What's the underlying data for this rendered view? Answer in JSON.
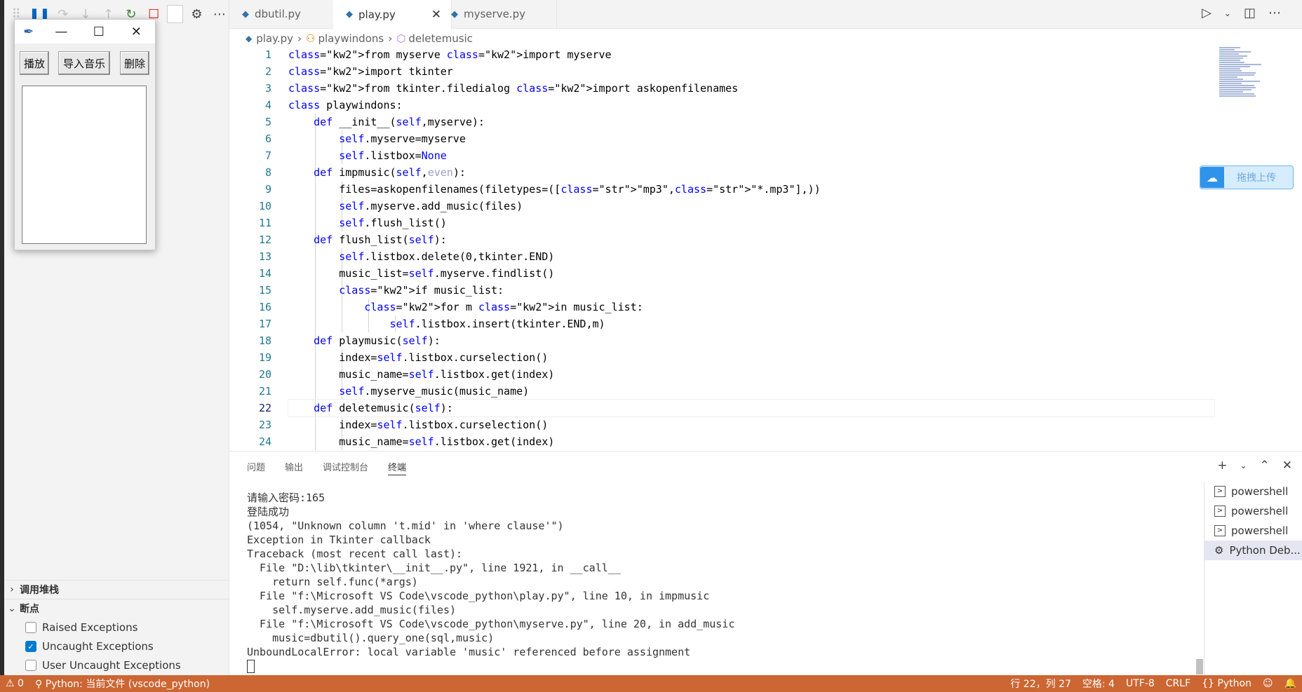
{
  "debug_toolbar": {
    "icons": [
      "gripper-icon",
      "pause-icon",
      "step-over-icon",
      "step-into-icon",
      "step-out-icon",
      "restart-icon",
      "stop-icon"
    ]
  },
  "sidebar": {
    "call_stack_label": "调用堆栈",
    "breakpoints_label": "断点",
    "breakpoints": [
      {
        "label": "Raised Exceptions",
        "checked": false
      },
      {
        "label": "Uncaught Exceptions",
        "checked": true
      },
      {
        "label": "User Uncaught Exceptions",
        "checked": false
      }
    ]
  },
  "tk_window": {
    "buttons": {
      "play": "播放",
      "import": "导入音乐",
      "delete": "删除"
    }
  },
  "tabs": [
    {
      "label": "dbutil.py",
      "active": false
    },
    {
      "label": "play.py",
      "active": true
    },
    {
      "label": "myserve.py",
      "active": false
    }
  ],
  "breadcrumb": {
    "file": "play.py",
    "class": "playwindons",
    "method": "deletemusic"
  },
  "editor": {
    "current_line": 22,
    "line_numbers": [
      "1",
      "2",
      "3",
      "4",
      "5",
      "6",
      "7",
      "8",
      "9",
      "10",
      "11",
      "12",
      "13",
      "14",
      "15",
      "16",
      "17",
      "18",
      "19",
      "20",
      "21",
      "22",
      "23",
      "24"
    ],
    "lines": [
      "from myserve import myserve",
      "import tkinter",
      "from tkinter.filedialog import askopenfilenames",
      "class playwindons:",
      "    def __init__(self,myserve):",
      "        self.myserve=myserve",
      "        self.listbox=None",
      "    def impmusic(self,even):",
      "        files=askopenfilenames(filetypes=([\"mp3\",\"*.mp3\"],))",
      "        self.myserve.add_music(files)",
      "        self.flush_list()",
      "    def flush_list(self):",
      "        self.listbox.delete(0,tkinter.END)",
      "        music_list=self.myserve.findlist()",
      "        if music_list:",
      "            for m in music_list:",
      "                self.listbox.insert(tkinter.END,m)",
      "    def playmusic(self):",
      "        index=self.listbox.curselection()",
      "        music_name=self.listbox.get(index)",
      "        self.myserve_music(music_name)",
      "    def deletemusic(self):",
      "        index=self.listbox.curselection()",
      "        music_name=self.listbox.get(index)"
    ]
  },
  "upload_button": {
    "label": "拖拽上传"
  },
  "panel": {
    "tabs": [
      "问题",
      "输出",
      "调试控制台",
      "终端"
    ],
    "active_tab": "终端"
  },
  "terminal": {
    "lines": [
      "请输入密码:165",
      "登陆成功",
      "(1054, \"Unknown column 't.mid' in 'where clause'\")",
      "Exception in Tkinter callback",
      "Traceback (most recent call last):",
      "  File \"D:\\lib\\tkinter\\__init__.py\", line 1921, in __call__",
      "    return self.func(*args)",
      "  File \"f:\\Microsoft VS Code\\vscode_python\\play.py\", line 10, in impmusic",
      "    self.myserve.add_music(files)",
      "  File \"f:\\Microsoft VS Code\\vscode_python\\myserve.py\", line 20, in add_music",
      "    music=dbutil().query_one(sql,music)",
      "UnboundLocalError: local variable 'music' referenced before assignment"
    ],
    "instances": [
      {
        "label": "powershell",
        "icon": "terminal-icon"
      },
      {
        "label": "powershell",
        "icon": "terminal-icon"
      },
      {
        "label": "powershell",
        "icon": "terminal-icon"
      },
      {
        "label": "Python Deb...",
        "icon": "bug-icon"
      }
    ]
  },
  "statusbar": {
    "errors": "0",
    "interpreter": "Python: 当前文件 (vscode_python)",
    "position": "行 22，列 27",
    "spaces": "空格: 4",
    "encoding": "UTF-8",
    "eol": "CRLF",
    "language": "Python",
    "color": "#cc6633"
  }
}
